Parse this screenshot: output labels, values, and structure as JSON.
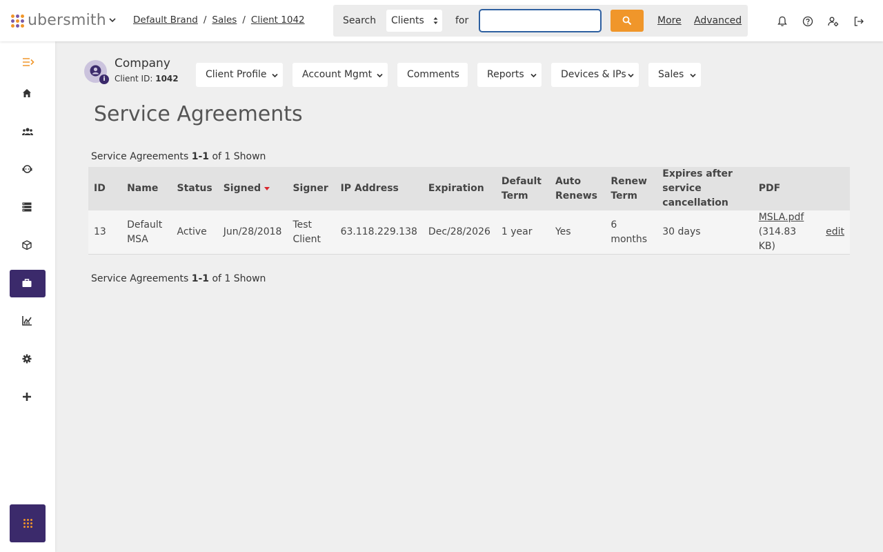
{
  "brand": {
    "name": "ubersmith"
  },
  "breadcrumb": [
    "Default Brand",
    "Sales",
    "Client 1042"
  ],
  "search": {
    "label": "Search",
    "scope": "Clients",
    "for_label": "for",
    "value": "",
    "more": "More",
    "advanced": "Advanced"
  },
  "client": {
    "name": "Company",
    "id_label": "Client ID:",
    "id": "1042"
  },
  "nav": [
    "Client Profile",
    "Account Mgmt",
    "Comments",
    "Reports",
    "Devices & IPs",
    "Sales"
  ],
  "page": {
    "title": "Service Agreements",
    "shown_prefix": "Service Agreements",
    "shown_range": "1-1",
    "shown_suffix": "of 1 Shown"
  },
  "table": {
    "headers": [
      "ID",
      "Name",
      "Status",
      "Signed",
      "Signer",
      "IP Address",
      "Expiration",
      "Default Term",
      "Auto Renews",
      "Renew Term",
      "Expires after service cancellation",
      "PDF",
      ""
    ],
    "rows": [
      {
        "id": "13",
        "name": "Default MSA",
        "status": "Active",
        "signed": "Jun/28/2018",
        "signer": "Test Client",
        "ip": "63.118.229.138",
        "expiration": "Dec/28/2026",
        "default_term": "1 year",
        "auto_renews": "Yes",
        "renew_term": "6 months",
        "expires_after": "30 days",
        "pdf_name": "MSLA.pdf",
        "pdf_size": "(314.83 KB)",
        "action": "edit"
      }
    ]
  },
  "colors": {
    "accent": "#f0962a",
    "brand_purple": "#3b2a6b",
    "sort_arrow": "#d9262c"
  }
}
